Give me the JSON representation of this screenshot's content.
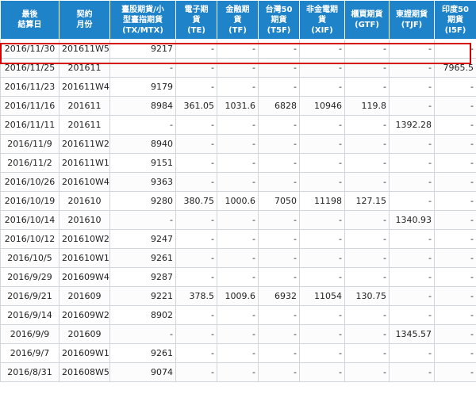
{
  "table": {
    "headers": [
      "最後\n結算日",
      "契約\n月份",
      "臺股期貨/小\n型臺指期貨\n(TX/MTX)",
      "電子期\n貨\n(TE)",
      "金融期\n貨\n(TF)",
      "台灣50\n期貨\n(T5F)",
      "非金電期\n貨\n(XIF)",
      "櫃買期貨\n(GTF)",
      "東證期貨\n(TJF)",
      "印度50\n期貨\n(I5F)"
    ],
    "rows": [
      [
        "2016/11/30",
        "201611W5",
        "9217",
        "-",
        "-",
        "-",
        "-",
        "-",
        "-",
        "-"
      ],
      [
        "2016/11/25",
        "201611",
        "-",
        "-",
        "-",
        "-",
        "-",
        "-",
        "-",
        "7965.5"
      ],
      [
        "2016/11/23",
        "201611W4",
        "9179",
        "-",
        "-",
        "-",
        "-",
        "-",
        "-",
        "-"
      ],
      [
        "2016/11/16",
        "201611",
        "8984",
        "361.05",
        "1031.6",
        "6828",
        "10946",
        "119.8",
        "-",
        "-"
      ],
      [
        "2016/11/11",
        "201611",
        "-",
        "-",
        "-",
        "-",
        "-",
        "-",
        "1392.28",
        "-"
      ],
      [
        "2016/11/9",
        "201611W2",
        "8940",
        "-",
        "-",
        "-",
        "-",
        "-",
        "-",
        "-"
      ],
      [
        "2016/11/2",
        "201611W1",
        "9151",
        "-",
        "-",
        "-",
        "-",
        "-",
        "-",
        "-"
      ],
      [
        "2016/10/26",
        "201610W4",
        "9363",
        "-",
        "-",
        "-",
        "-",
        "-",
        "-",
        "-"
      ],
      [
        "2016/10/19",
        "201610",
        "9280",
        "380.75",
        "1000.6",
        "7050",
        "11198",
        "127.15",
        "-",
        "-"
      ],
      [
        "2016/10/14",
        "201610",
        "-",
        "-",
        "-",
        "-",
        "-",
        "-",
        "1340.93",
        "-"
      ],
      [
        "2016/10/12",
        "201610W2",
        "9247",
        "-",
        "-",
        "-",
        "-",
        "-",
        "-",
        "-"
      ],
      [
        "2016/10/5",
        "201610W1",
        "9261",
        "-",
        "-",
        "-",
        "-",
        "-",
        "-",
        "-"
      ],
      [
        "2016/9/29",
        "201609W4",
        "9287",
        "-",
        "-",
        "-",
        "-",
        "-",
        "-",
        "-"
      ],
      [
        "2016/9/21",
        "201609",
        "9221",
        "378.5",
        "1009.6",
        "6932",
        "11054",
        "130.75",
        "-",
        "-"
      ],
      [
        "2016/9/14",
        "201609W2",
        "8902",
        "-",
        "-",
        "-",
        "-",
        "-",
        "-",
        "-"
      ],
      [
        "2016/9/9",
        "201609",
        "-",
        "-",
        "-",
        "-",
        "-",
        "-",
        "1345.57",
        "-"
      ],
      [
        "2016/9/7",
        "201609W1",
        "9261",
        "-",
        "-",
        "-",
        "-",
        "-",
        "-",
        "-"
      ],
      [
        "2016/8/31",
        "201608W5",
        "9074",
        "-",
        "-",
        "-",
        "-",
        "-",
        "-",
        "-"
      ]
    ]
  },
  "colors": {
    "header_bg": "#1f83c9",
    "highlight_border": "#d40000"
  }
}
